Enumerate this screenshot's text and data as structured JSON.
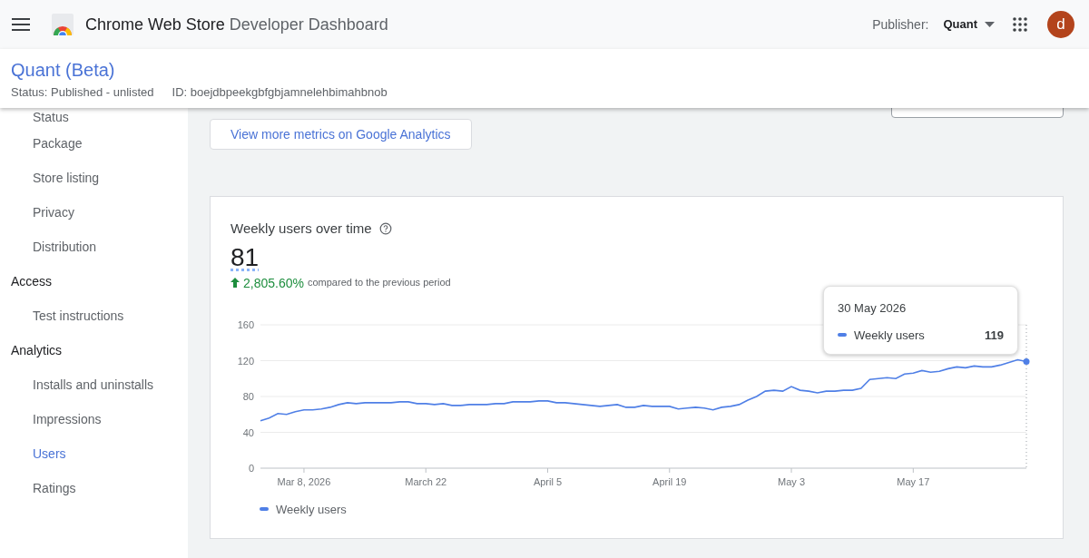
{
  "topbar": {
    "title_bold": "Chrome Web Store",
    "title_light": "Developer Dashboard",
    "publisher_label": "Publisher:",
    "publisher": "Quant",
    "avatar": "d"
  },
  "item": {
    "name": "Quant (Beta)",
    "status": "Status: Published - unlisted",
    "id": "ID: boejdbpeekgbfgbjamnelehbimahbnob"
  },
  "sidebar": {
    "sections": [
      {
        "items": [
          {
            "label": "Status",
            "selected": false
          },
          {
            "label": "Package",
            "selected": false
          },
          {
            "label": "Store listing",
            "selected": false
          },
          {
            "label": "Privacy",
            "selected": false
          },
          {
            "label": "Distribution",
            "selected": false
          }
        ]
      },
      {
        "title": "Access",
        "items": [
          {
            "label": "Test instructions",
            "selected": false
          }
        ]
      },
      {
        "title": "Analytics",
        "items": [
          {
            "label": "Installs and uninstalls",
            "selected": false
          },
          {
            "label": "Impressions",
            "selected": false
          },
          {
            "label": "Users",
            "selected": true
          },
          {
            "label": "Ratings",
            "selected": false
          }
        ]
      }
    ]
  },
  "analytics_button": "View more metrics on Google Analytics",
  "card": {
    "title": "Weekly users over time",
    "total": "81",
    "change": "2,805.60%",
    "change_note": "compared to the previous period",
    "chart_data": {
      "type": "line",
      "categories": [
        null,
        null,
        null,
        null,
        null,
        "Mar 8, 2026",
        null,
        null,
        null,
        null,
        null,
        null,
        null,
        null,
        null,
        null,
        null,
        null,
        null,
        "March 22",
        null,
        null,
        null,
        null,
        null,
        null,
        null,
        null,
        null,
        null,
        null,
        null,
        null,
        "April 5",
        null,
        null,
        null,
        null,
        null,
        null,
        null,
        null,
        null,
        null,
        null,
        null,
        null,
        "April 19",
        null,
        null,
        null,
        null,
        null,
        null,
        null,
        null,
        null,
        null,
        null,
        null,
        null,
        "May 3",
        null,
        null,
        null,
        null,
        null,
        null,
        null,
        null,
        null,
        null,
        null,
        null,
        null,
        "May 17",
        null,
        null,
        null,
        null,
        null,
        null,
        null,
        null,
        null,
        null,
        null,
        null,
        null
      ],
      "series": [
        {
          "name": "Weekly users",
          "color": "#4f7fe6",
          "values": [
            53,
            56,
            61,
            60,
            63,
            65,
            65,
            66,
            68,
            71,
            73,
            72,
            73,
            73,
            73,
            73,
            74,
            74,
            72,
            72,
            71,
            72,
            70,
            70,
            71,
            71,
            71,
            72,
            72,
            74,
            74,
            74,
            75,
            75,
            73,
            73,
            72,
            71,
            70,
            69,
            70,
            71,
            68,
            68,
            70,
            69,
            69,
            69,
            66,
            67,
            68,
            67,
            65,
            68,
            69,
            71,
            76,
            80,
            86,
            87,
            86,
            91,
            87,
            86,
            84,
            86,
            86,
            87,
            87,
            89,
            99,
            100,
            101,
            100,
            105,
            106,
            109,
            107,
            108,
            111,
            113,
            112,
            114,
            113,
            113,
            115,
            118,
            121,
            119
          ]
        }
      ],
      "ylim": [
        0,
        160
      ],
      "grid": true,
      "yticks": [
        0,
        40,
        80,
        120,
        160
      ]
    },
    "tooltip": {
      "date": "30 May 2026",
      "series": "Weekly users",
      "value": "119"
    }
  }
}
